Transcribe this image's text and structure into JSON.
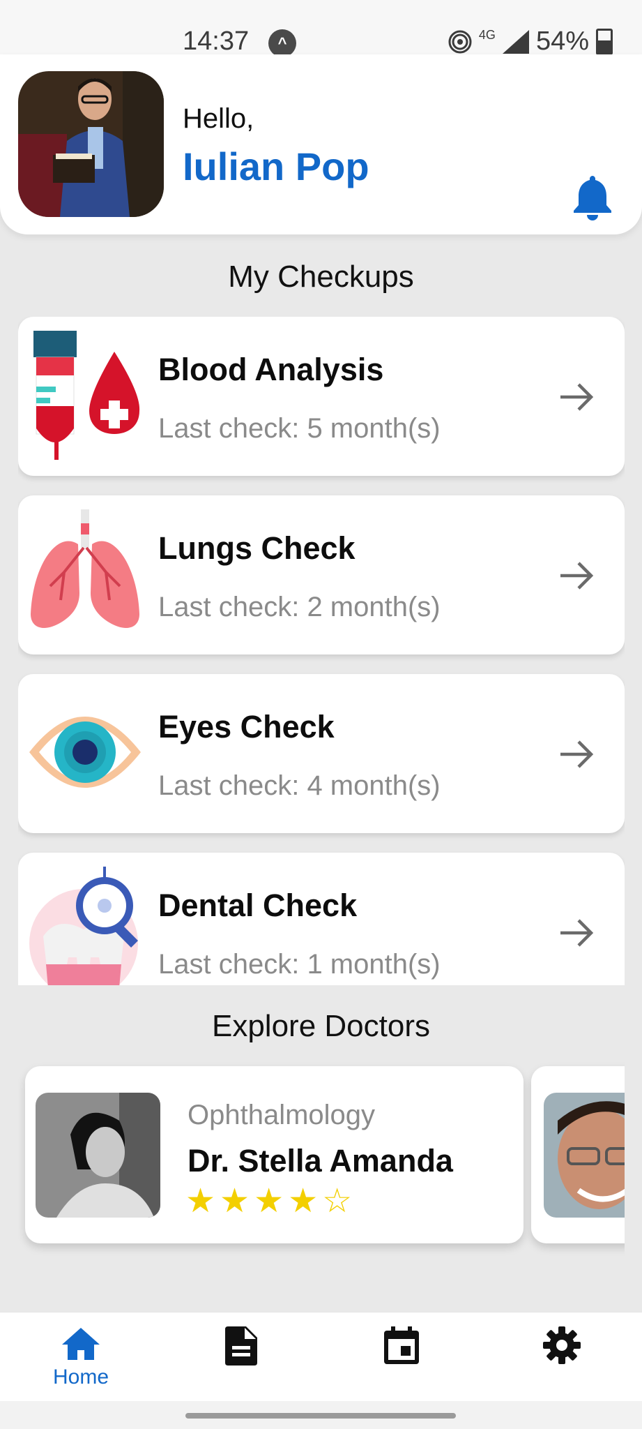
{
  "status_bar": {
    "time": "14:37",
    "network": "4G",
    "battery": "54%"
  },
  "header": {
    "greeting": "Hello,",
    "user_name": "Iulian Pop"
  },
  "checkups": {
    "title": "My Checkups",
    "items": [
      {
        "title": "Blood Analysis",
        "subtitle": "Last check: 5 month(s)",
        "icon": "blood-test-icon"
      },
      {
        "title": "Lungs Check",
        "subtitle": "Last check: 2 month(s)",
        "icon": "lungs-icon"
      },
      {
        "title": "Eyes Check",
        "subtitle": "Last check: 4 month(s)",
        "icon": "eye-icon"
      },
      {
        "title": "Dental Check",
        "subtitle": "Last check: 1 month(s)",
        "icon": "tooth-icon"
      }
    ]
  },
  "doctors": {
    "title": "Explore Doctors",
    "items": [
      {
        "specialty": "Ophthalmology",
        "name": "Dr. Stella Amanda",
        "rating": 4,
        "max_rating": 5
      }
    ]
  },
  "bottom_nav": {
    "items": [
      {
        "label": "Home",
        "icon": "home-icon",
        "active": true
      },
      {
        "label": "",
        "icon": "document-icon",
        "active": false
      },
      {
        "label": "",
        "icon": "calendar-icon",
        "active": false
      },
      {
        "label": "",
        "icon": "settings-icon",
        "active": false
      }
    ]
  },
  "colors": {
    "accent": "#1268c9",
    "star": "#f3cf00",
    "background": "#e9e9e9"
  }
}
